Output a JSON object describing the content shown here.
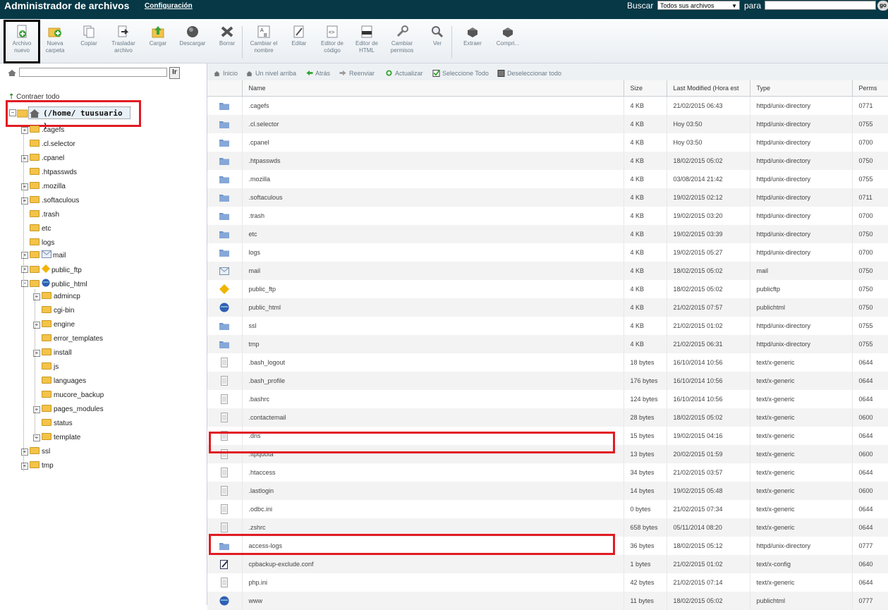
{
  "header": {
    "title": "Administrador de archivos",
    "config_link": "Configuración",
    "search_label": "Buscar",
    "search_scope": "Todos sus archivos",
    "search_for": "para",
    "go_label": "go"
  },
  "toolbar": [
    {
      "icon": "new-file-icon",
      "label": "Archivo nuevo"
    },
    {
      "icon": "new-folder-icon",
      "label": "Nueva carpeta"
    },
    {
      "icon": "copy-icon",
      "label": "Copiar"
    },
    {
      "icon": "move-icon",
      "label": "Trasladar archivo"
    },
    {
      "icon": "upload-icon",
      "label": "Cargar"
    },
    {
      "icon": "download-icon",
      "label": "Descargar"
    },
    {
      "icon": "delete-icon",
      "label": "Borrar"
    },
    {
      "icon": "rename-icon",
      "label": "Cambiar el nombre"
    },
    {
      "icon": "edit-icon",
      "label": "Editar"
    },
    {
      "icon": "code-editor-icon",
      "label": "Editor de código"
    },
    {
      "icon": "html-editor-icon",
      "label": "Editor de HTML"
    },
    {
      "icon": "permissions-icon",
      "label": "Cambiar permisos"
    },
    {
      "icon": "view-icon",
      "label": "Ver"
    },
    {
      "icon": "extract-icon",
      "label": "Extraer"
    },
    {
      "icon": "compress-icon",
      "label": "Compri..."
    }
  ],
  "left": {
    "go_label": "Ir",
    "collapse_label": "Contraer todo",
    "root_label": "(/home/ tuusuario )",
    "tree": [
      {
        "label": ".cagefs",
        "depth": 1,
        "expand": true
      },
      {
        "label": ".cl.selector",
        "depth": 1,
        "expand": false
      },
      {
        "label": ".cpanel",
        "depth": 1,
        "expand": true
      },
      {
        "label": ".htpasswds",
        "depth": 1,
        "expand": false
      },
      {
        "label": ".mozilla",
        "depth": 1,
        "expand": true
      },
      {
        "label": ".softaculous",
        "depth": 1,
        "expand": true
      },
      {
        "label": ".trash",
        "depth": 1,
        "expand": false
      },
      {
        "label": "etc",
        "depth": 1,
        "expand": false
      },
      {
        "label": "logs",
        "depth": 1,
        "expand": false
      },
      {
        "label": "mail",
        "depth": 1,
        "expand": true
      },
      {
        "label": "public_ftp",
        "depth": 1,
        "expand": true
      },
      {
        "label": "public_html",
        "depth": 1,
        "expand": true
      },
      {
        "label": "admincp",
        "depth": 2,
        "expand": true
      },
      {
        "label": "cgi-bin",
        "depth": 2,
        "expand": false
      },
      {
        "label": "engine",
        "depth": 2,
        "expand": true
      },
      {
        "label": "error_templates",
        "depth": 2,
        "expand": false
      },
      {
        "label": "install",
        "depth": 2,
        "expand": true
      },
      {
        "label": "js",
        "depth": 2,
        "expand": false
      },
      {
        "label": "languages",
        "depth": 2,
        "expand": false
      },
      {
        "label": "mucore_backup",
        "depth": 2,
        "expand": false
      },
      {
        "label": "pages_modules",
        "depth": 2,
        "expand": true
      },
      {
        "label": "status",
        "depth": 2,
        "expand": false
      },
      {
        "label": "template",
        "depth": 2,
        "expand": true
      },
      {
        "label": "ssl",
        "depth": 1,
        "expand": true
      },
      {
        "label": "tmp",
        "depth": 1,
        "expand": true
      }
    ]
  },
  "nav": [
    {
      "icon": "home-icon",
      "label": "Inicio"
    },
    {
      "icon": "up-level-icon",
      "label": "Un nivel arriba"
    },
    {
      "icon": "back-icon",
      "label": "Atrás"
    },
    {
      "icon": "forward-icon",
      "label": "Reenviar"
    },
    {
      "icon": "refresh-icon",
      "label": "Actualizar"
    },
    {
      "icon": "select-all-icon",
      "label": "Seleccione Todo"
    },
    {
      "icon": "deselect-all-icon",
      "label": "Deseleccionar todo"
    }
  ],
  "table": {
    "columns": [
      "Name",
      "Size",
      "Last Modified (Hora est",
      "Type",
      "Perms"
    ],
    "rows": [
      {
        "icon": "folder",
        "name": ".cagefs",
        "size": "4 KB",
        "modified": "21/02/2015 06:43",
        "type": "httpd/unix-directory",
        "perms": "0771"
      },
      {
        "icon": "folder",
        "name": ".cl.selector",
        "size": "4 KB",
        "modified": "Hoy 03:50",
        "type": "httpd/unix-directory",
        "perms": "0755"
      },
      {
        "icon": "folder",
        "name": ".cpanel",
        "size": "4 KB",
        "modified": "Hoy 03:50",
        "type": "httpd/unix-directory",
        "perms": "0700"
      },
      {
        "icon": "folder",
        "name": ".htpasswds",
        "size": "4 KB",
        "modified": "18/02/2015 05:02",
        "type": "httpd/unix-directory",
        "perms": "0750"
      },
      {
        "icon": "folder",
        "name": ".mozilla",
        "size": "4 KB",
        "modified": "03/08/2014 21:42",
        "type": "httpd/unix-directory",
        "perms": "0755"
      },
      {
        "icon": "folder",
        "name": ".softaculous",
        "size": "4 KB",
        "modified": "19/02/2015 02:12",
        "type": "httpd/unix-directory",
        "perms": "0711"
      },
      {
        "icon": "folder",
        "name": ".trash",
        "size": "4 KB",
        "modified": "19/02/2015 03:20",
        "type": "httpd/unix-directory",
        "perms": "0700"
      },
      {
        "icon": "folder",
        "name": "etc",
        "size": "4 KB",
        "modified": "19/02/2015 03:39",
        "type": "httpd/unix-directory",
        "perms": "0750"
      },
      {
        "icon": "folder",
        "name": "logs",
        "size": "4 KB",
        "modified": "19/02/2015 05:27",
        "type": "httpd/unix-directory",
        "perms": "0700"
      },
      {
        "icon": "mail",
        "name": "mail",
        "size": "4 KB",
        "modified": "18/02/2015 05:02",
        "type": "mail",
        "perms": "0750"
      },
      {
        "icon": "ftp",
        "name": "public_ftp",
        "size": "4 KB",
        "modified": "18/02/2015 05:02",
        "type": "publicftp",
        "perms": "0750"
      },
      {
        "icon": "globe",
        "name": "public_html",
        "size": "4 KB",
        "modified": "21/02/2015 07:57",
        "type": "publichtml",
        "perms": "0750"
      },
      {
        "icon": "folder",
        "name": "ssl",
        "size": "4 KB",
        "modified": "21/02/2015 01:02",
        "type": "httpd/unix-directory",
        "perms": "0755"
      },
      {
        "icon": "folder",
        "name": "tmp",
        "size": "4 KB",
        "modified": "21/02/2015 06:31",
        "type": "httpd/unix-directory",
        "perms": "0755"
      },
      {
        "icon": "file",
        "name": ".bash_logout",
        "size": "18 bytes",
        "modified": "16/10/2014 10:56",
        "type": "text/x-generic",
        "perms": "0644"
      },
      {
        "icon": "file",
        "name": ".bash_profile",
        "size": "176 bytes",
        "modified": "16/10/2014 10:56",
        "type": "text/x-generic",
        "perms": "0644"
      },
      {
        "icon": "file",
        "name": ".bashrc",
        "size": "124 bytes",
        "modified": "16/10/2014 10:56",
        "type": "text/x-generic",
        "perms": "0644"
      },
      {
        "icon": "file",
        "name": ".contactemail",
        "size": "28 bytes",
        "modified": "18/02/2015 05:02",
        "type": "text/x-generic",
        "perms": "0600"
      },
      {
        "icon": "file",
        "name": ".dns",
        "size": "15 bytes",
        "modified": "19/02/2015 04:16",
        "type": "text/x-generic",
        "perms": "0644"
      },
      {
        "icon": "file",
        "name": ".ftpquota",
        "size": "13 bytes",
        "modified": "20/02/2015 01:59",
        "type": "text/x-generic",
        "perms": "0600"
      },
      {
        "icon": "file",
        "name": ".htaccess",
        "size": "34 bytes",
        "modified": "21/02/2015 03:57",
        "type": "text/x-generic",
        "perms": "0644"
      },
      {
        "icon": "file",
        "name": ".lastlogin",
        "size": "14 bytes",
        "modified": "19/02/2015 05:48",
        "type": "text/x-generic",
        "perms": "0600"
      },
      {
        "icon": "file",
        "name": ".odbc.ini",
        "size": "0 bytes",
        "modified": "21/02/2015 07:34",
        "type": "text/x-generic",
        "perms": "0644"
      },
      {
        "icon": "file",
        "name": ".zshrc",
        "size": "658 bytes",
        "modified": "05/11/2014 08:20",
        "type": "text/x-generic",
        "perms": "0644"
      },
      {
        "icon": "folder",
        "name": "access-logs",
        "size": "36 bytes",
        "modified": "18/02/2015 05:12",
        "type": "httpd/unix-directory",
        "perms": "0777"
      },
      {
        "icon": "config",
        "name": "cpbackup-exclude.conf",
        "size": "1 bytes",
        "modified": "21/02/2015 01:02",
        "type": "text/x-config",
        "perms": "0640"
      },
      {
        "icon": "file",
        "name": "php.ini",
        "size": "42 bytes",
        "modified": "21/02/2015 07:14",
        "type": "text/x-generic",
        "perms": "0644"
      },
      {
        "icon": "globe",
        "name": "www",
        "size": "11 bytes",
        "modified": "18/02/2015 05:02",
        "type": "publichtml",
        "perms": "0777"
      }
    ]
  },
  "colors": {
    "header_bg": "#063846",
    "highlight": "#e11b23"
  }
}
